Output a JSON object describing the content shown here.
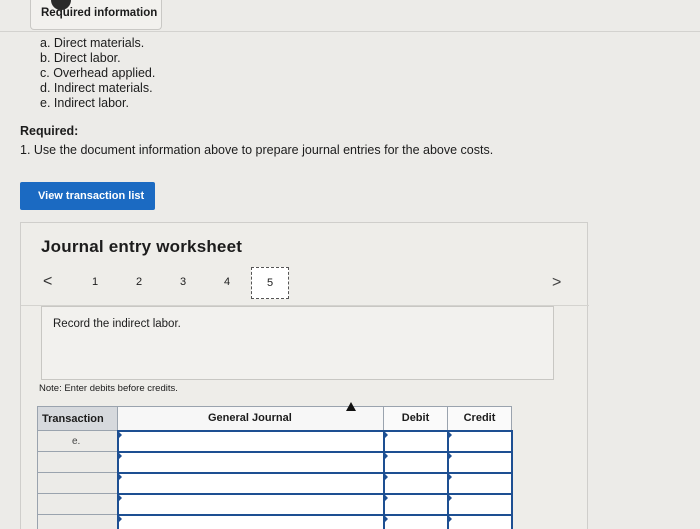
{
  "info": {
    "tab_label": "Required information",
    "items": [
      "a. Direct materials.",
      "b. Direct labor.",
      "c. Overhead applied.",
      "d. Indirect materials.",
      "e. Indirect labor."
    ]
  },
  "required": {
    "heading": "Required:",
    "text": "1. Use the document information above to prepare journal entries for the above costs."
  },
  "view_button_label": "View transaction list",
  "worksheet": {
    "title": "Journal entry worksheet",
    "prev_arrow": "<",
    "next_arrow": ">",
    "pages": [
      "1",
      "2",
      "3",
      "4",
      "5"
    ],
    "current_page": "5",
    "description": "Record the indirect labor.",
    "note": "Note: Enter debits before credits."
  },
  "table": {
    "headers": {
      "transaction": "Transaction",
      "general_journal": "General Journal",
      "debit": "Debit",
      "credit": "Credit"
    },
    "rows": [
      {
        "transaction": "e.",
        "general_journal": "",
        "debit": "",
        "credit": ""
      },
      {
        "transaction": "",
        "general_journal": "",
        "debit": "",
        "credit": ""
      },
      {
        "transaction": "",
        "general_journal": "",
        "debit": "",
        "credit": ""
      },
      {
        "transaction": "",
        "general_journal": "",
        "debit": "",
        "credit": ""
      },
      {
        "transaction": "",
        "general_journal": "",
        "debit": "",
        "credit": ""
      }
    ]
  },
  "colors": {
    "accent": "#1b6ac2",
    "input_border": "#1d4f92"
  }
}
